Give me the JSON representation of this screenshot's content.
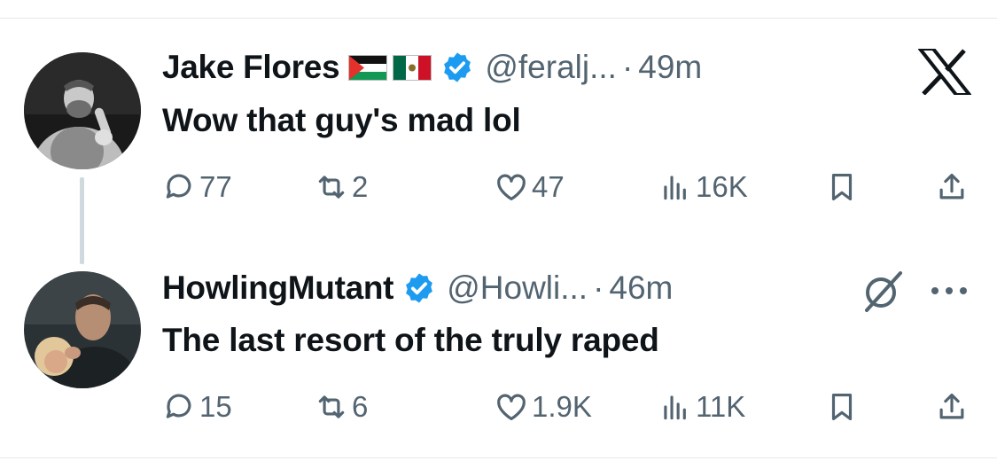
{
  "tweets": [
    {
      "name": "Jake Flores",
      "handle": "@feralj...",
      "separator": "·",
      "time": "49m",
      "text": "Wow that guy's mad lol",
      "flags": [
        "palestine-flag",
        "mexico-flag"
      ],
      "verified": true,
      "stats": {
        "replies": "77",
        "retweets": "2",
        "likes": "47",
        "views": "16K"
      }
    },
    {
      "name": "HowlingMutant",
      "handle": "@Howli...",
      "separator": "·",
      "time": "46m",
      "text": "The last resort of the truly raped",
      "verified": true,
      "stats": {
        "replies": "15",
        "retweets": "6",
        "likes": "1.9K",
        "views": "11K"
      }
    }
  ],
  "icons": {
    "top_right": "x-logo-icon",
    "grok": "grok-icon",
    "more": "more-icon"
  },
  "colors": {
    "text": "#0f1419",
    "secondary": "#536471",
    "verified": "#1d9bf0",
    "divider": "#e6e8ea",
    "thread_line": "#cfd9de"
  }
}
